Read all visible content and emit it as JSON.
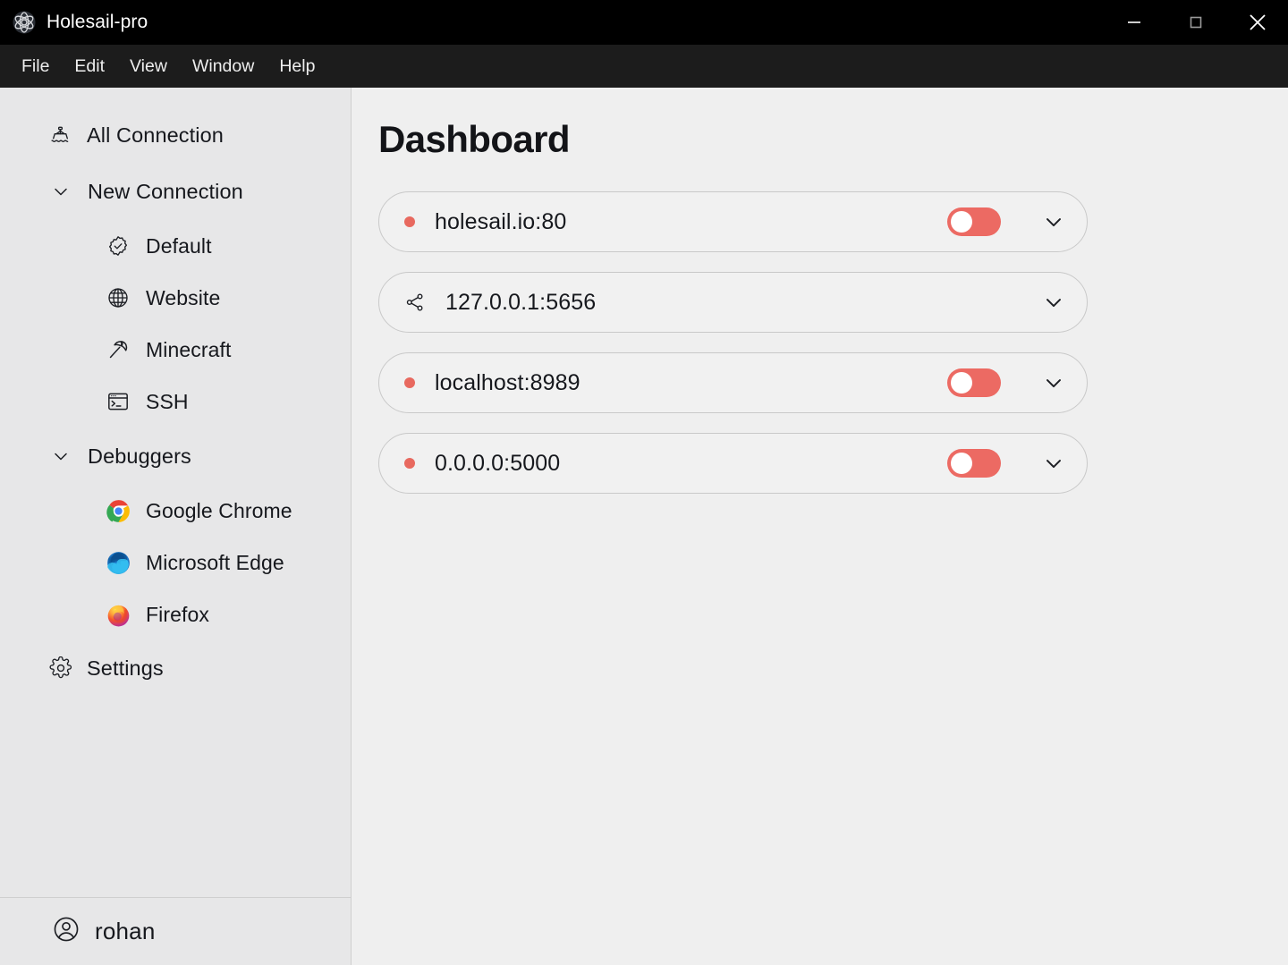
{
  "window": {
    "title": "Holesail-pro",
    "app_icon": "electron-atom-icon",
    "controls": {
      "minimize": "minimize-icon",
      "maximize": "maximize-icon",
      "close": "close-icon"
    }
  },
  "menubar": {
    "items": [
      {
        "label": "File"
      },
      {
        "label": "Edit"
      },
      {
        "label": "View"
      },
      {
        "label": "Window"
      },
      {
        "label": "Help"
      }
    ]
  },
  "sidebar": {
    "items": [
      {
        "label": "All Connection",
        "icon": "ship-icon",
        "type": "item"
      },
      {
        "label": "New Connection",
        "icon": "chevron-down-icon",
        "type": "group",
        "expanded": true
      },
      {
        "label": "Default",
        "icon": "badge-check-icon",
        "type": "child"
      },
      {
        "label": "Website",
        "icon": "globe-icon",
        "type": "child"
      },
      {
        "label": "Minecraft",
        "icon": "pickaxe-icon",
        "type": "child"
      },
      {
        "label": "SSH",
        "icon": "terminal-icon",
        "type": "child"
      },
      {
        "label": "Debuggers",
        "icon": "chevron-down-icon",
        "type": "group",
        "expanded": true
      },
      {
        "label": "Google Chrome",
        "icon": "chrome-icon",
        "type": "child"
      },
      {
        "label": "Microsoft Edge",
        "icon": "edge-icon",
        "type": "child"
      },
      {
        "label": "Firefox",
        "icon": "firefox-icon",
        "type": "child"
      },
      {
        "label": "Settings",
        "icon": "gear-icon",
        "type": "item"
      }
    ],
    "footer": {
      "user_name": "rohan",
      "avatar_icon": "user-circle-icon"
    }
  },
  "main": {
    "title": "Dashboard",
    "connections": [
      {
        "name": "holesail.io:80",
        "leading_icon": "status-dot",
        "status_color": "#e8695f",
        "has_toggle": true,
        "toggle_on": false,
        "toggle_color": "#ec6a63",
        "chevron": "chevron-down-icon"
      },
      {
        "name": "127.0.0.1:5656",
        "leading_icon": "share-icon",
        "status_color": "",
        "has_toggle": false,
        "toggle_on": false,
        "toggle_color": "",
        "chevron": "chevron-down-icon"
      },
      {
        "name": "localhost:8989",
        "leading_icon": "status-dot",
        "status_color": "#e8695f",
        "has_toggle": true,
        "toggle_on": false,
        "toggle_color": "#ec6a63",
        "chevron": "chevron-down-icon"
      },
      {
        "name": "0.0.0.0:5000",
        "leading_icon": "status-dot",
        "status_color": "#e8695f",
        "has_toggle": true,
        "toggle_on": false,
        "toggle_color": "#ec6a63",
        "chevron": "chevron-down-icon"
      }
    ]
  },
  "colors": {
    "titlebar_bg": "#000000",
    "menubar_bg": "#1c1c1c",
    "sidebar_bg": "#e7e7e8",
    "main_bg": "#efefef",
    "card_bg": "#f1f1f1",
    "accent_coral": "#ec6a63",
    "text_primary": "#16181d"
  }
}
